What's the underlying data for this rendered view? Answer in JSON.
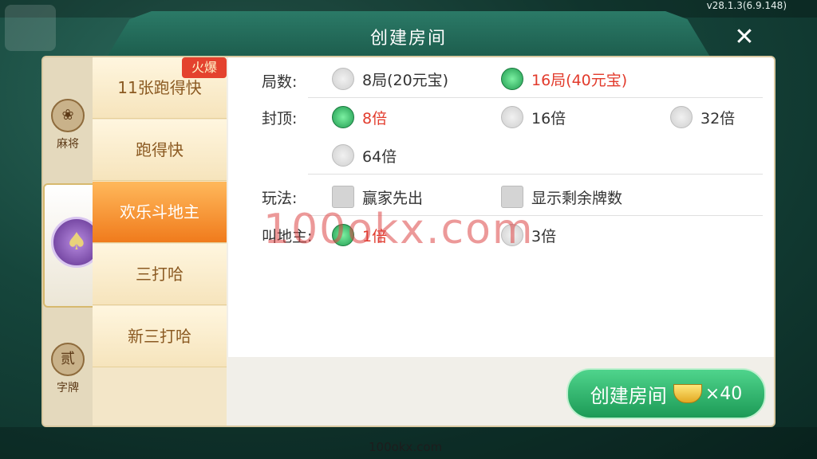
{
  "app": {
    "version": "v28.1.3(6.9.148)",
    "footer_watermark": "100okx.com"
  },
  "dialog": {
    "title": "创建房间",
    "close_glyph": "✕"
  },
  "categories": [
    {
      "label": "麻将",
      "icon": "mahjong-icon",
      "glyph": "❀"
    },
    {
      "label": "",
      "icon": "poker-spade-icon",
      "glyph": "♠"
    },
    {
      "label": "字牌",
      "icon": "zipai-icon",
      "glyph": "贰"
    }
  ],
  "games": [
    {
      "label": "11张跑得快",
      "badge": "火爆"
    },
    {
      "label": "跑得快"
    },
    {
      "label": "欢乐斗地主"
    },
    {
      "label": "三打哈"
    },
    {
      "label": "新三打哈"
    }
  ],
  "options": {
    "rounds": {
      "label": "局数:",
      "choices": [
        "8局(20元宝)",
        "16局(40元宝)"
      ],
      "selected": "16局(40元宝)"
    },
    "cap": {
      "label": "封顶:",
      "choices": [
        "8倍",
        "16倍",
        "32倍",
        "64倍"
      ],
      "selected": "8倍"
    },
    "play": {
      "label": "玩法:",
      "choices": [
        "赢家先出",
        "显示剩余牌数"
      ]
    },
    "landlord": {
      "label": "叫地主:",
      "choices": [
        "1倍",
        "3倍"
      ],
      "selected": "1倍"
    }
  },
  "watermark": "100okx.com",
  "create_button": {
    "label": "创建房间",
    "cost": "×40"
  },
  "colors": {
    "accent_green": "#1c9a56",
    "selected_text": "#e23b2c",
    "active_tab": "#f07b1c"
  }
}
